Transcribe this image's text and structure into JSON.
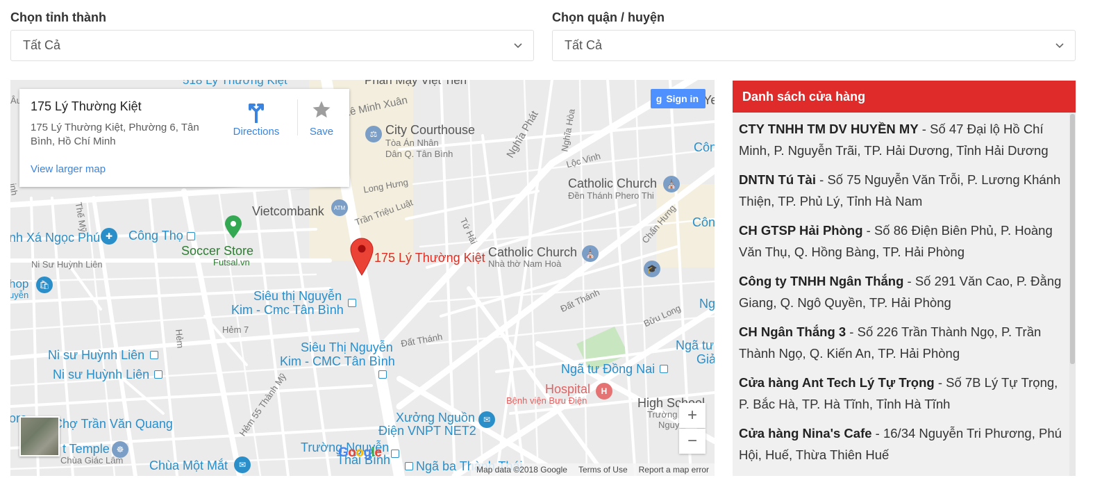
{
  "filters": {
    "province_label": "Chọn tỉnh thành",
    "province_value": "Tất Cả",
    "district_label": "Chọn quận / huyện",
    "district_value": "Tất Cả"
  },
  "map": {
    "card": {
      "title": "175 Lý Thường Kiệt",
      "address": "175 Lý Thường Kiệt, Phường 6, Tân Bình, Hồ Chí Minh",
      "larger_map": "View larger map",
      "directions": "Directions",
      "save": "Save"
    },
    "signin": "Sign in",
    "marker_label": "175 Lý Thường Kiệt",
    "places": {
      "courthouse": "City Courthouse",
      "courthouse_sub1": "Tòa Án Nhân",
      "courthouse_sub2": "Dân Q. Tân Bình",
      "catholic1": "Catholic Church",
      "catholic1_sub": "Đền Thánh Phero Thi",
      "vietcombank": "Vietcombank",
      "cong_tho": "Công Thọ",
      "soccer": "Soccer Store",
      "soccer_sub": "Futsal.vn",
      "xa_ngoc_phu": "nh Xá Ngọc Phú",
      "catholic2": "Catholic Church",
      "catholic2_sub": "Nhà thờ Nam Hoà",
      "sieuthi1_a": "Siêu thị Nguyễn",
      "sieuthi1_b": "Kim - Cmc Tân Bình",
      "sieuthi2_a": "Siêu Thị Nguyễn",
      "sieuthi2_b": "Kim - CMC Tân Bình",
      "ni_su_1": "Ni sư Huỳnh Liên",
      "ni_su_2": "Ni sư Huỳnh Liên",
      "nga_tu_dong_nai": "Ngã tư Đồng Nai",
      "hospital": "Hospital",
      "hospital_sub": "Bệnh viện Bưu Điện",
      "high_school": "High School",
      "hs_sub1": "Trường",
      "hs_sub2": "Nguy",
      "cho_tran": "Chợ Trần Văn Quang",
      "xuong_a": "Xưởng Nguồn",
      "xuong_b": "Điện VNPT NET2",
      "temple": "t Temple",
      "temple_sub": "Chùa Giác Lâm",
      "chua_mot_mat": "Chùa Một Mắt",
      "truong_nguyen": "Trường Nguyễn",
      "thai_binh": "Thái Bình",
      "nga_ba": "Ngã ba Thành Thái",
      "nga_tu_gia_a": "Ngã tư",
      "nga_tu_gia_b": "Giả",
      "hop": "hop",
      "hop_sub": "uyễn",
      "ore": "ore",
      "con1": "Côn",
      "con2": "Côn",
      "ng": "Ng",
      "ye": "Ye",
      "top_road": "518 Lý Thường Kiệt",
      "top_road2": "Phan Mạy Việt Tiến"
    },
    "roads": {
      "le_minh_xuan": "Lê Minh Xuân",
      "nghia_phat": "Nghĩa Phát",
      "nghia_hoa": "Nghĩa Hòa",
      "loc_vinh": "Lộc Vinh",
      "long_hung": "Long Hưng",
      "tran_trieu_luat": "Trần Triệu Luật",
      "tu_hai": "Tứ Hải",
      "chan_hung": "Chấn Hưng",
      "ni_su": "Ni Sư Huỳnh Liên",
      "the_my": "Thế Mỹ",
      "hem7": "Hẻm 7",
      "hem": "Hẻm",
      "hem55": "Hẻm 55 Thành Mỹ",
      "dat_thanh1": "Đất Thánh",
      "dat_thanh2": "Đất Thánh",
      "buu_long": "Bửu Long",
      "au": "Âu",
      "inh": "inh"
    },
    "google": "Google",
    "attribution": {
      "data": "Map data ©2018 Google",
      "terms": "Terms of Use",
      "report": "Report a map error"
    },
    "zoom_in": "+",
    "zoom_out": "−"
  },
  "store_list": {
    "title": "Danh sách cửa hàng",
    "stores": [
      {
        "name": "CTY TNHH TM DV HUYỀN MY",
        "address": " - Số 47 Đại lộ Hồ Chí Minh, P. Nguyễn Trãi, TP. Hải Dương, Tỉnh Hải Dương"
      },
      {
        "name": "DNTN Tú Tài",
        "address": " - Số 75 Nguyễn Văn Trỗi, P. Lương Khánh Thiện, TP. Phủ Lý, Tỉnh Hà Nam"
      },
      {
        "name": "CH GTSP Hải Phòng",
        "address": " - Số 86 Điện Biên Phủ, P. Hoàng Văn Thụ, Q. Hồng Bàng, TP. Hải Phòng"
      },
      {
        "name": "Công ty TNHH Ngân Thắng",
        "address": " - Số 291 Văn Cao, P. Đằng Giang, Q. Ngô Quyền, TP. Hải Phòng"
      },
      {
        "name": "CH Ngân Thắng 3",
        "address": " - Số 226 Trần Thành Ngọ, P. Trần Thành Ngọ, Q. Kiến An, TP. Hải Phòng"
      },
      {
        "name": "Cửa hàng Ant Tech Lý Tự Trọng",
        "address": " - Số 7B Lý Tự Trọng, P. Bắc Hà, TP. Hà Tĩnh, Tỉnh Hà Tĩnh"
      },
      {
        "name": "Cửa hàng Nina's Cafe",
        "address": " - 16/34 Nguyễn Tri Phương, Phú Hội, Huế, Thừa Thiên Huế"
      }
    ]
  },
  "colors": {
    "list_header": "#e02b2b",
    "link": "#3a84df",
    "marker": "#ea4335"
  }
}
